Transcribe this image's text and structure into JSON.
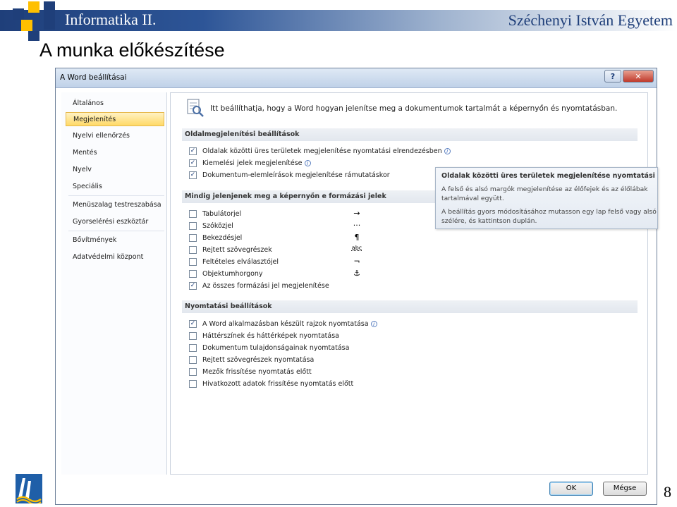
{
  "slide": {
    "course_title": "Informatika II.",
    "university": "Széchenyi István Egyetem",
    "title": "A munka előkészítése",
    "page_number": "8"
  },
  "dialog": {
    "title": "A Word beállításai",
    "help_label": "?",
    "close_label": "✕",
    "intro": "Itt beállíthatja, hogy a Word hogyan jelenítse meg a dokumentumok tartalmát a képernyőn és nyomtatásban.",
    "nav": [
      {
        "label": "Általános"
      },
      {
        "label": "Megjelenítés"
      },
      {
        "label": "Nyelvi ellenőrzés"
      },
      {
        "label": "Mentés"
      },
      {
        "label": "Nyelv"
      },
      {
        "label": "Speciális"
      },
      {
        "label": "Menüszalag testreszabása"
      },
      {
        "label": "Gyorselérési eszköztár"
      },
      {
        "label": "Bővítmények"
      },
      {
        "label": "Adatvédelmi központ"
      }
    ],
    "active_nav": "Megjelenítés",
    "sections": {
      "page_display": {
        "header": "Oldalmegjelenítési beállítások",
        "options": [
          {
            "label": "Oldalak közötti üres területek megjelenítése nyomtatási elrendezésben",
            "checked": true
          },
          {
            "label": "Kiemelési jelek megjelenítése",
            "checked": true
          },
          {
            "label": "Dokumentum-elemleírások megjelenítése rámutatáskor",
            "checked": true
          }
        ]
      },
      "formatting_marks": {
        "header": "Mindig jelenjenek meg a képernyőn e formázási jelek",
        "options": [
          {
            "label": "Tabulátorjel",
            "checked": false,
            "symbol": "→"
          },
          {
            "label": "Szóközjel",
            "checked": false,
            "symbol": "···"
          },
          {
            "label": "Bekezdésjel",
            "checked": false,
            "symbol": "¶"
          },
          {
            "label": "Rejtett szövegrészek",
            "checked": false,
            "symbol": "abc"
          },
          {
            "label": "Feltételes elválasztójel",
            "checked": false,
            "symbol": "¬"
          },
          {
            "label": "Objektumhorgony",
            "checked": false,
            "symbol": "⚓"
          },
          {
            "label": "Az összes formázási jel megjelenítése",
            "checked": true
          }
        ]
      },
      "printing": {
        "header": "Nyomtatási beállítások",
        "options": [
          {
            "label": "A Word alkalmazásban készült rajzok nyomtatása",
            "checked": true
          },
          {
            "label": "Háttérszínek és háttérképek nyomtatása",
            "checked": false
          },
          {
            "label": "Dokumentum tulajdonságainak nyomtatása",
            "checked": false
          },
          {
            "label": "Rejtett szövegrészek nyomtatása",
            "checked": false
          },
          {
            "label": "Mezők frissítése nyomtatás előtt",
            "checked": false
          },
          {
            "label": "Hivatkozott adatok frissítése nyomtatás előtt",
            "checked": false
          }
        ]
      }
    },
    "tooltip": {
      "title": "Oldalak közötti üres területek megjelenítése nyomtatási elrendezés",
      "line1": "A felső és alsó margók megjelenítése az élőfejek és az élőlábak",
      "line2": "tartalmával együtt.",
      "line3": "A beállítás gyors módosításához mutasson egy lap felső vagy alsó",
      "line4": "szélére, és kattintson duplán."
    },
    "buttons": {
      "ok": "OK",
      "cancel": "Mégse"
    },
    "colors": {
      "accent": "#1f3f7a",
      "highlight": "#ffc000",
      "selected_nav": "#ffd966"
    }
  }
}
